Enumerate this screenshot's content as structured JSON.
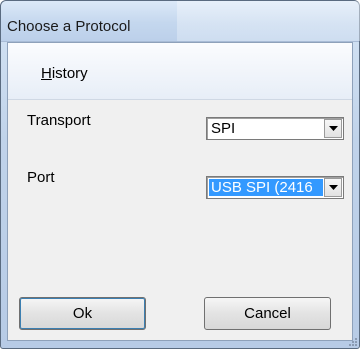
{
  "window": {
    "title": "Choose a Protocol"
  },
  "menu": {
    "history_label": "History",
    "history_accel": "H",
    "history_rest": "istory"
  },
  "form": {
    "transport_label": "Transport",
    "transport_value": "SPI",
    "port_label": "Port",
    "port_value": "USB SPI (2416"
  },
  "buttons": {
    "ok_label": "Ok",
    "cancel_label": "Cancel"
  },
  "icons": {
    "dropdown": "chevron-down-icon"
  },
  "colors": {
    "selection": "#3399ff",
    "titlebar": "#c4d7ee"
  }
}
